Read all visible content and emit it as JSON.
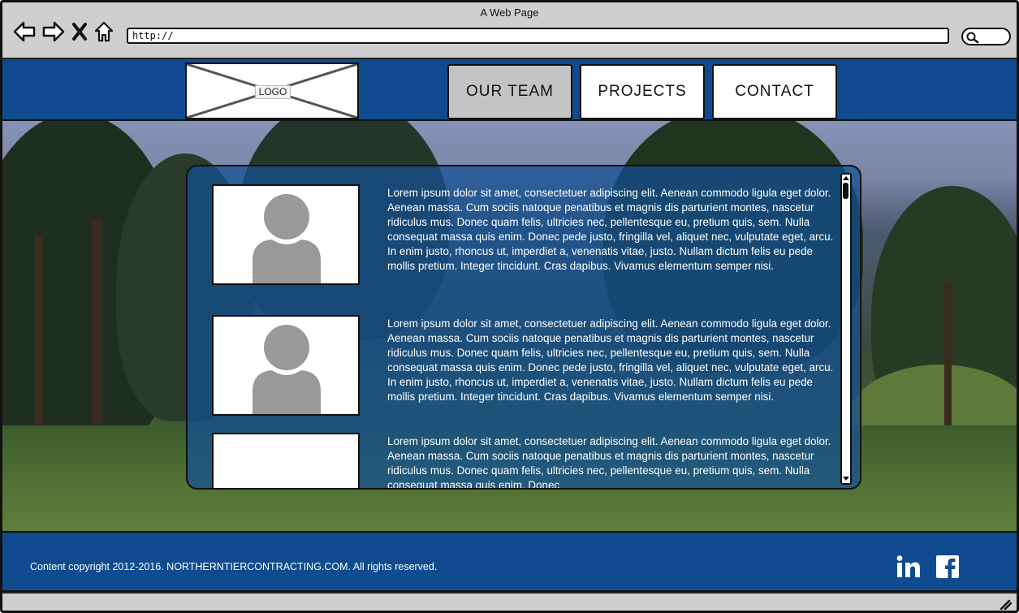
{
  "window": {
    "title": "A Web Page"
  },
  "browser": {
    "url": "http://",
    "icons": [
      "back-arrow-icon",
      "forward-arrow-icon",
      "close-x-icon",
      "home-icon",
      "search-icon"
    ]
  },
  "header": {
    "logo_label": "LOGO",
    "nav": [
      {
        "label": "OUR TEAM",
        "active": true
      },
      {
        "label": "PROJECTS",
        "active": false
      },
      {
        "label": "CONTACT",
        "active": false
      }
    ]
  },
  "team": {
    "members": [
      {
        "bio": "Lorem ipsum dolor sit amet, consectetuer adipiscing elit. Aenean commodo ligula eget dolor. Aenean massa. Cum sociis natoque penatibus et magnis dis parturient montes, nascetur ridiculus mus. Donec quam felis, ultricies nec, pellentesque eu, pretium quis, sem. Nulla consequat massa quis enim. Donec pede justo, fringilla vel, aliquet nec, vulputate eget, arcu. In enim justo, rhoncus ut, imperdiet a, venenatis vitae, justo. Nullam dictum felis eu pede mollis pretium. Integer tincidunt. Cras dapibus. Vivamus elementum semper nisi."
      },
      {
        "bio": "Lorem ipsum dolor sit amet, consectetuer adipiscing elit. Aenean commodo ligula eget dolor. Aenean massa. Cum sociis natoque penatibus et magnis dis parturient montes, nascetur ridiculus mus. Donec quam felis, ultricies nec, pellentesque eu, pretium quis, sem. Nulla consequat massa quis enim. Donec pede justo, fringilla vel, aliquet nec, vulputate eget, arcu. In enim justo, rhoncus ut, imperdiet a, venenatis vitae, justo. Nullam dictum felis eu pede mollis pretium. Integer tincidunt. Cras dapibus. Vivamus elementum semper nisi."
      },
      {
        "bio": "Lorem ipsum dolor sit amet, consectetuer adipiscing elit. Aenean commodo ligula eget dolor. Aenean massa. Cum sociis natoque penatibus et magnis dis parturient montes, nascetur ridiculus mus. Donec quam felis, ultricies nec, pellentesque eu, pretium quis, sem. Nulla consequat massa quis enim. Donec"
      }
    ]
  },
  "footer": {
    "copyright": "Content copyright 2012-2016. NORTHERNTIERCONTRACTING.COM. All rights reserved.",
    "social": [
      "linkedin-icon",
      "facebook-icon"
    ]
  },
  "colors": {
    "brand_blue": "#0f4b8e",
    "panel_blue": "#125094",
    "active_tab": "#c4c4c4",
    "avatar_gray": "#999999"
  }
}
